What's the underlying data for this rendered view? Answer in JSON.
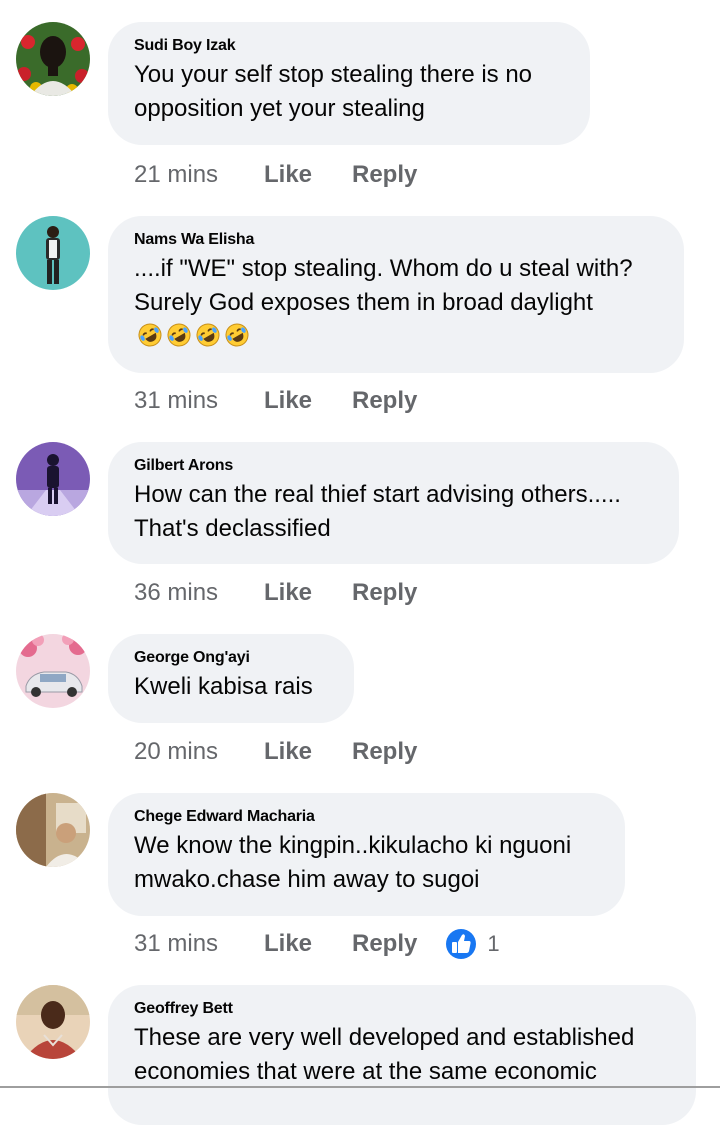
{
  "comments": [
    {
      "name": "Sudi Boy Izak",
      "text": "You your self stop stealing there is no opposition yet your stealing",
      "time": "21 mins",
      "like_label": "Like",
      "reply_label": "Reply"
    },
    {
      "name": "Nams Wa Elisha",
      "text": "....if \"WE\" stop stealing. Whom do u steal with? Surely God exposes them in broad daylight",
      "emoji": "rolling-on-floor-laughing-emoji",
      "emoji_count": 4,
      "time": "31 mins",
      "like_label": "Like",
      "reply_label": "Reply"
    },
    {
      "name": "Gilbert Arons",
      "text": "How can the real thief start advising others..... That's declassified",
      "time": "36 mins",
      "like_label": "Like",
      "reply_label": "Reply"
    },
    {
      "name": "George Ong'ayi",
      "text": "Kweli kabisa rais",
      "time": "20 mins",
      "like_label": "Like",
      "reply_label": "Reply"
    },
    {
      "name": "Chege Edward Macharia",
      "text": "We know the kingpin..kikulacho ki nguoni mwako.chase him away to sugoi",
      "time": "31 mins",
      "like_label": "Like",
      "reply_label": "Reply",
      "reaction": {
        "icon": "thumbs-up-icon",
        "count": "1"
      }
    },
    {
      "name": "Geoffrey Bett",
      "text": "These are very well developed and established economies that were at the same economic"
    }
  ],
  "colors": {
    "bubble": "#f0f2f5",
    "meta_text": "#65676b",
    "like_blue": "#1877f2"
  }
}
